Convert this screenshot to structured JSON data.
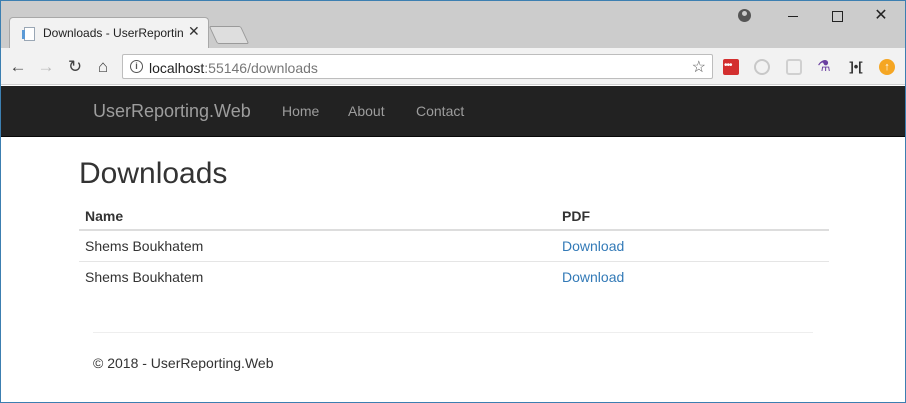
{
  "browser": {
    "tab": {
      "title": "Downloads - UserReporting.Web"
    },
    "address": {
      "host": "localhost",
      "rest": ":55146/downloads"
    },
    "window_controls": {
      "close": "✕"
    },
    "icons": [
      "back-icon",
      "forward-icon",
      "reload-icon",
      "home-icon",
      "info-icon",
      "star-icon"
    ]
  },
  "navbar": {
    "brand": "UserReporting.Web",
    "links": [
      "Home",
      "About",
      "Contact"
    ]
  },
  "page": {
    "title": "Downloads",
    "table": {
      "headers": [
        "Name",
        "PDF"
      ],
      "rows": [
        {
          "name": "Shems Boukhatem",
          "pdf": "Download"
        },
        {
          "name": "Shems Boukhatem",
          "pdf": "Download"
        }
      ]
    },
    "footer": "© 2018 - UserReporting.Web"
  },
  "colors": {
    "navbar_bg": "#222222",
    "navbar_text": "#9d9d9d",
    "link": "#337ab7",
    "window_border": "#3c7fb1"
  }
}
